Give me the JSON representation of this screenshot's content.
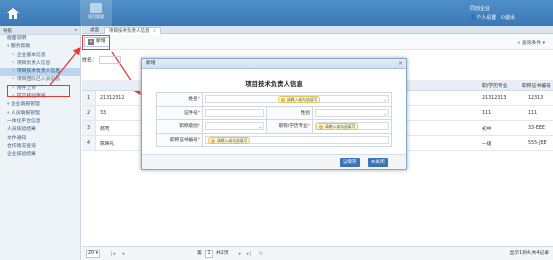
{
  "top_nav": {
    "main_label": "项目管理",
    "company": "同创企业",
    "user": "个人设置",
    "exit": "退出"
  },
  "sidebar": {
    "header": "导航",
    "items": [
      {
        "label": "版面说明",
        "type": "top"
      },
      {
        "label": "服务帮助",
        "type": "group"
      },
      {
        "label": "企业基本信息",
        "type": "sub"
      },
      {
        "label": "项目负责人信息",
        "type": "sub"
      },
      {
        "label": "项目技术负责人信息",
        "type": "sub",
        "active": true
      },
      {
        "label": "项目团队已入员信息",
        "type": "sub"
      },
      {
        "label": "附件上传",
        "type": "sub"
      },
      {
        "label": "提交核验审核",
        "type": "sub"
      },
      {
        "label": "企业填报管理",
        "type": "group"
      },
      {
        "label": "人员填报管理",
        "type": "group"
      },
      {
        "label": "一体化平台信息",
        "type": "top"
      },
      {
        "label": "人员核验结果",
        "type": "top"
      },
      {
        "label": "文件通知",
        "type": "top"
      },
      {
        "label": "合作情况查询",
        "type": "top"
      },
      {
        "label": "企业核验结果",
        "type": "top"
      }
    ]
  },
  "tabs": [
    {
      "label": "桌面"
    },
    {
      "label": "项目技术负责人信息"
    }
  ],
  "toolbar": {
    "add_label": "新增",
    "search_label": "查询条件"
  },
  "filter": {
    "label": "姓名："
  },
  "table": {
    "headers": [
      "职/学历专业",
      "职称证书编号"
    ],
    "rows": [
      {
        "num": "1",
        "name": "21312312",
        "major": "21312313",
        "cert": "12313"
      },
      {
        "num": "2",
        "name": "33",
        "major": "111",
        "cert": "111"
      },
      {
        "num": "3",
        "name": "郝芳",
        "major": "初中",
        "cert": "33-EEE"
      },
      {
        "num": "4",
        "name": "陈映礼",
        "major": "一级",
        "cert": "555-JEE"
      }
    ]
  },
  "pager": {
    "page_size": "20",
    "page": "1",
    "prefix": "第",
    "suffix": "共2页",
    "summary": "显示1到4,共4记录"
  },
  "dialog": {
    "title": "新增",
    "form_title": "项目技术负责人信息",
    "fields": {
      "name_label": "姓名",
      "id_label": "证件号",
      "gender_label": "性别",
      "level_label": "职称级别",
      "major_label": "职称/学历专业",
      "cert_label": "职称证书编号",
      "tip": "请输入或勾选填写"
    },
    "save": "保存",
    "close": "关闭"
  }
}
